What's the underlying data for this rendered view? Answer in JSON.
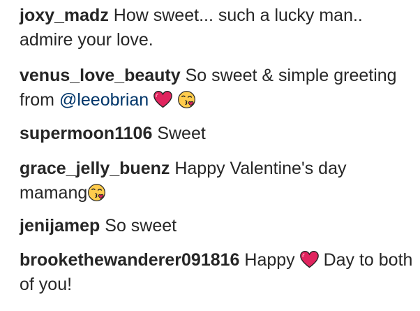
{
  "comments": [
    {
      "user": "joxy_madz",
      "text": "How sweet... such a lucky man.. admire your love."
    },
    {
      "user": "venus_love_beauty",
      "text": "So sweet & simple greeting from",
      "mention": "@leeobrian"
    },
    {
      "user": "supermoon1106",
      "text": "Sweet"
    },
    {
      "user": "grace_jelly_buenz",
      "text": "Happy Valentine's day mamang"
    },
    {
      "user": "jenijamep",
      "text": "So sweet"
    },
    {
      "user": "brookethewanderer091816",
      "text_before": "Happy",
      "text_after": "Day to both of you!"
    }
  ],
  "icons": {
    "heart": "red-heart-icon",
    "kiss": "face-blowing-kiss-icon"
  },
  "colors": {
    "text": "#262626",
    "mention": "#003569",
    "heart": "#e0245e"
  }
}
